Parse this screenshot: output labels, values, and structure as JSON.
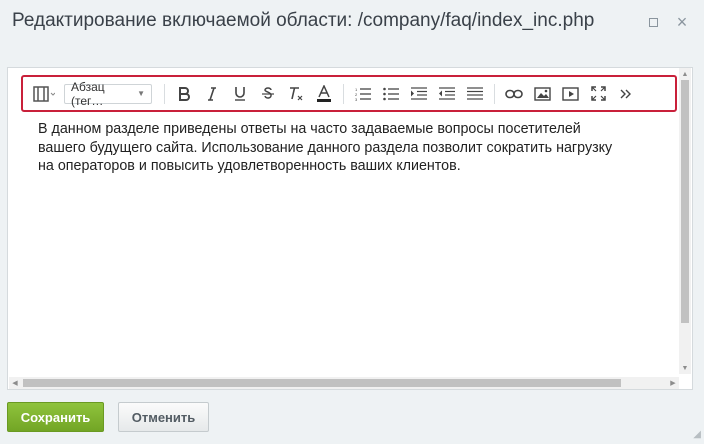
{
  "dialog": {
    "title": "Редактирование включаемой области: /company/faq/index_inc.php"
  },
  "toolbar": {
    "format_dropdown": "Абзац (тег…"
  },
  "content": {
    "lines": [
      "В данном разделе приведены ответы на часто задаваемые вопросы посетителей",
      "вашего будущего сайта. Использование данного раздела позволит сократить нагрузку",
      "на операторов и повысить удовлетворенность ваших клиентов."
    ]
  },
  "buttons": {
    "save": "Сохранить",
    "cancel": "Отменить"
  }
}
